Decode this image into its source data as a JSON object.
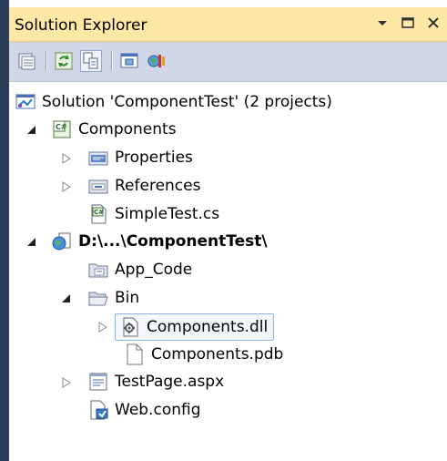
{
  "panel": {
    "title": "Solution Explorer",
    "title_buttons": [
      {
        "name": "dropdown-arrow-icon"
      },
      {
        "name": "maximize-icon"
      },
      {
        "name": "close-icon"
      }
    ]
  },
  "toolbar": {
    "buttons": [
      {
        "name": "properties-icon"
      },
      {
        "name": "refresh-icon"
      },
      {
        "name": "show-all-files-icon"
      },
      {
        "name": "view-designer-icon"
      },
      {
        "name": "copy-website-icon"
      }
    ]
  },
  "tree": {
    "items": [
      {
        "label": "Solution 'ComponentTest' (2 projects)",
        "icon": "solution-icon",
        "expander": "none"
      },
      {
        "label": "Components",
        "icon": "csharp-project-icon",
        "expander": "expanded"
      },
      {
        "label": "Properties",
        "icon": "properties-folder-icon",
        "expander": "collapsed"
      },
      {
        "label": "References",
        "icon": "references-folder-icon",
        "expander": "collapsed"
      },
      {
        "label": "SimpleTest.cs",
        "icon": "csharp-file-icon",
        "expander": "none"
      },
      {
        "label": "D:\\...\\ComponentTest\\",
        "icon": "website-project-icon",
        "expander": "expanded",
        "bold": true
      },
      {
        "label": "App_Code",
        "icon": "app-code-folder-icon",
        "expander": "none"
      },
      {
        "label": "Bin",
        "icon": "folder-open-icon",
        "expander": "expanded"
      },
      {
        "label": "Components.dll",
        "icon": "dll-file-icon",
        "expander": "collapsed",
        "selected": true
      },
      {
        "label": "Components.pdb",
        "icon": "blank-file-icon",
        "expander": "none"
      },
      {
        "label": "TestPage.aspx",
        "icon": "aspx-file-icon",
        "expander": "collapsed"
      },
      {
        "label": "Web.config",
        "icon": "config-file-icon",
        "expander": "none"
      }
    ]
  },
  "colors": {
    "title_bar": "#ffe8a6",
    "toolbar": "#cfd6e5",
    "frame": "#2c3d5a",
    "selection_border": "#8fb4e0"
  }
}
